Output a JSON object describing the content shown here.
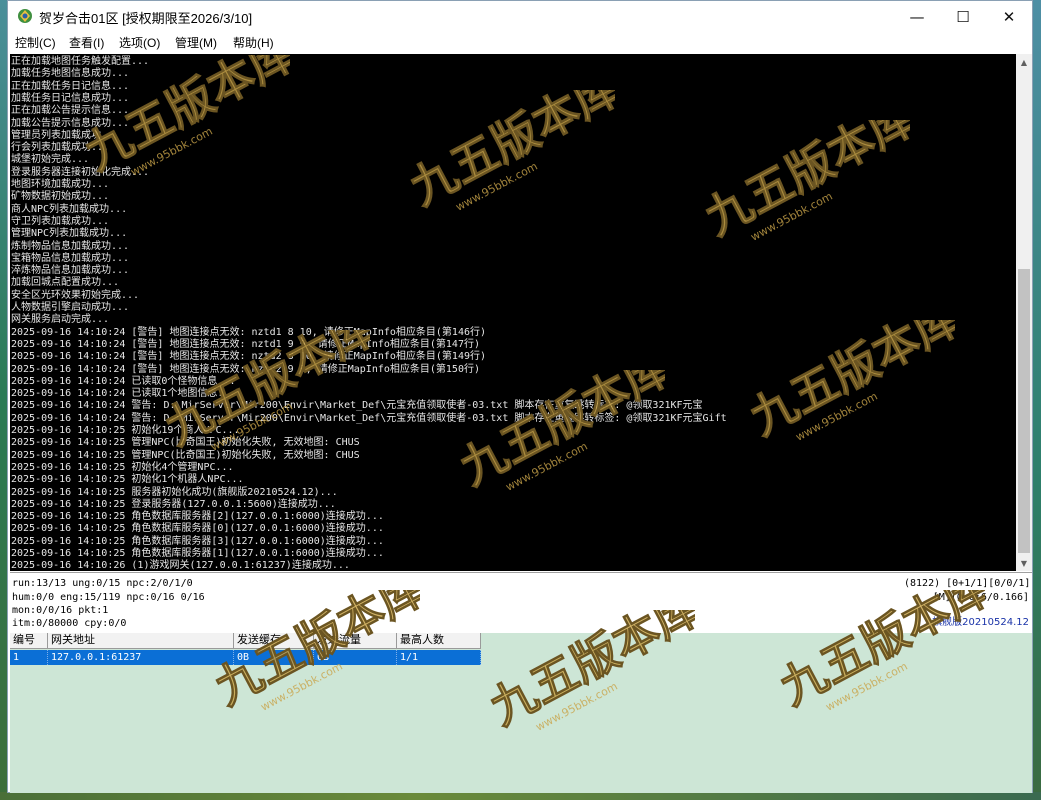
{
  "window": {
    "title": "贺岁合击01区 [授权期限至2026/3/10]",
    "minimize_glyph": "—",
    "maximize_glyph": "☐",
    "close_glyph": "✕"
  },
  "menu": [
    {
      "label": "控制(C)"
    },
    {
      "label": "查看(I)"
    },
    {
      "label": "选项(O)"
    },
    {
      "label": "管理(M)"
    },
    {
      "label": "帮助(H)"
    }
  ],
  "console_lines": [
    "正在加载地图任务触发配置...",
    "加载任务地图信息成功...",
    "正在加载任务日记信息...",
    "加载任务日记信息成功...",
    "正在加载公告提示信息...",
    "加载公告提示信息成功...",
    "管理员列表加载成功...",
    "行会列表加载成功...",
    "城堡初始完成...",
    "登录服务器连接初始化完成...",
    "地图环境加载成功...",
    "矿物数据初始成功...",
    "商人NPC列表加载成功...",
    "守卫列表加载成功...",
    "管理NPC列表加载成功...",
    "炼制物品信息加载成功...",
    "宝箱物品信息加载成功...",
    "淬炼物品信息加载成功...",
    "加载回城点配置成功...",
    "安全区光环效果初始完成...",
    "人物数据引擎启动成功...",
    "网关服务启动完成...",
    "2025-09-16 14:10:24 [警告] 地图连接点无效: nztd1 8 10, 请修正MapInfo相应条目(第146行)",
    "2025-09-16 14:10:24 [警告] 地图连接点无效: nztd1 9 9, 请修正MapInfo相应条目(第147行)",
    "2025-09-16 14:10:24 [警告] 地图连接点无效: nztd2 8 10, 请修正MapInfo相应条目(第149行)",
    "2025-09-16 14:10:24 [警告] 地图连接点无效: nztd2 9 9, 请修正MapInfo相应条目(第150行)",
    "2025-09-16 14:10:24 已读取0个怪物信息...",
    "2025-09-16 14:10:24 已读取1个地图信息...",
    "2025-09-16 14:10:24 警告: D:\\MirServer\\Mir200\\Envir\\Market_Def\\元宝充值领取使者-03.txt 脚本存在重复跳转标签: @领取321KF元宝",
    "2025-09-16 14:10:24 警告: D:\\MirServer\\Mir200\\Envir\\Market_Def\\元宝充值领取使者-03.txt 脚本存在重复跳转标签: @领取321KF元宝Gift",
    "2025-09-16 14:10:25 初始化19个商人NPC...",
    "2025-09-16 14:10:25 管理NPC(比奇国王)初始化失败, 无效地图: CHUS",
    "2025-09-16 14:10:25 管理NPC(比奇国王)初始化失败, 无效地图: CHUS",
    "2025-09-16 14:10:25 初始化4个管理NPC...",
    "2025-09-16 14:10:25 初始化1个机器人NPC...",
    "2025-09-16 14:10:25 服务器初始化成功(旗舰版20210524.12)...",
    "2025-09-16 14:10:25 登录服务器(127.0.0.1:5600)连接成功...",
    "2025-09-16 14:10:25 角色数据库服务器[2](127.0.0.1:6000)连接成功...",
    "2025-09-16 14:10:25 角色数据库服务器[0](127.0.0.1:6000)连接成功...",
    "2025-09-16 14:10:25 角色数据库服务器[3](127.0.0.1:6000)连接成功...",
    "2025-09-16 14:10:25 角色数据库服务器[1](127.0.0.1:6000)连接成功...",
    "2025-09-16 14:10:26 (1)游戏网关(127.0.0.1:61237)连接成功..."
  ],
  "status": {
    "line1": "run:13/13 ung:0/15 npc:2/0/1/0",
    "line2": "hum:0/0 eng:15/119 npc:0/16 0/16",
    "line3": "mon:0/0/16 pkt:1",
    "line4": "itm:0/80000 cpy:0/0",
    "right1": "(8122) [0+1/1][0/0/1]",
    "right2": "[M][0:0:6/0.166]",
    "version": "旗舰版20210524.12"
  },
  "gate_table": {
    "headers": [
      "编号",
      "网关地址",
      "发送缓存",
      "发送流量",
      "最高人数"
    ],
    "rows": [
      [
        "1",
        "127.0.0.1:61237",
        "0B",
        "0B",
        "1/1"
      ]
    ]
  },
  "watermark": {
    "text": "九五版本库",
    "url": "www.95bbk.com",
    "color": "#c9a44a"
  },
  "colors": {
    "console_bg": "#000000",
    "console_text": "#e6e6e6",
    "selected_row": "#0b6fd6",
    "grid_bg": "#cde6d6",
    "version_text": "#1a33a8"
  }
}
